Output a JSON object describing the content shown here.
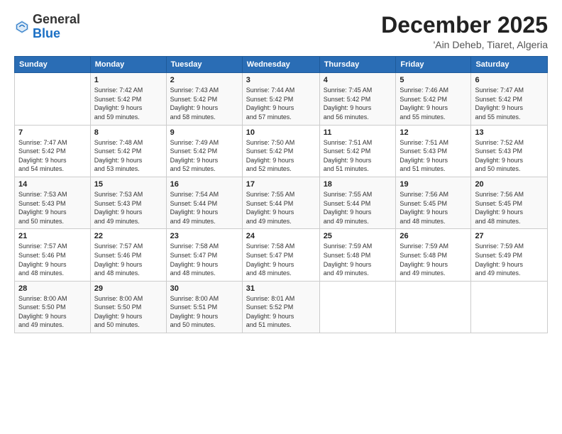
{
  "logo": {
    "general": "General",
    "blue": "Blue"
  },
  "header": {
    "month": "December 2025",
    "location": "'Ain Deheb, Tiaret, Algeria"
  },
  "days_of_week": [
    "Sunday",
    "Monday",
    "Tuesday",
    "Wednesday",
    "Thursday",
    "Friday",
    "Saturday"
  ],
  "weeks": [
    [
      {
        "day": "",
        "info": ""
      },
      {
        "day": "1",
        "info": "Sunrise: 7:42 AM\nSunset: 5:42 PM\nDaylight: 9 hours\nand 59 minutes."
      },
      {
        "day": "2",
        "info": "Sunrise: 7:43 AM\nSunset: 5:42 PM\nDaylight: 9 hours\nand 58 minutes."
      },
      {
        "day": "3",
        "info": "Sunrise: 7:44 AM\nSunset: 5:42 PM\nDaylight: 9 hours\nand 57 minutes."
      },
      {
        "day": "4",
        "info": "Sunrise: 7:45 AM\nSunset: 5:42 PM\nDaylight: 9 hours\nand 56 minutes."
      },
      {
        "day": "5",
        "info": "Sunrise: 7:46 AM\nSunset: 5:42 PM\nDaylight: 9 hours\nand 55 minutes."
      },
      {
        "day": "6",
        "info": "Sunrise: 7:47 AM\nSunset: 5:42 PM\nDaylight: 9 hours\nand 55 minutes."
      }
    ],
    [
      {
        "day": "7",
        "info": "Sunrise: 7:47 AM\nSunset: 5:42 PM\nDaylight: 9 hours\nand 54 minutes."
      },
      {
        "day": "8",
        "info": "Sunrise: 7:48 AM\nSunset: 5:42 PM\nDaylight: 9 hours\nand 53 minutes."
      },
      {
        "day": "9",
        "info": "Sunrise: 7:49 AM\nSunset: 5:42 PM\nDaylight: 9 hours\nand 52 minutes."
      },
      {
        "day": "10",
        "info": "Sunrise: 7:50 AM\nSunset: 5:42 PM\nDaylight: 9 hours\nand 52 minutes."
      },
      {
        "day": "11",
        "info": "Sunrise: 7:51 AM\nSunset: 5:42 PM\nDaylight: 9 hours\nand 51 minutes."
      },
      {
        "day": "12",
        "info": "Sunrise: 7:51 AM\nSunset: 5:43 PM\nDaylight: 9 hours\nand 51 minutes."
      },
      {
        "day": "13",
        "info": "Sunrise: 7:52 AM\nSunset: 5:43 PM\nDaylight: 9 hours\nand 50 minutes."
      }
    ],
    [
      {
        "day": "14",
        "info": "Sunrise: 7:53 AM\nSunset: 5:43 PM\nDaylight: 9 hours\nand 50 minutes."
      },
      {
        "day": "15",
        "info": "Sunrise: 7:53 AM\nSunset: 5:43 PM\nDaylight: 9 hours\nand 49 minutes."
      },
      {
        "day": "16",
        "info": "Sunrise: 7:54 AM\nSunset: 5:44 PM\nDaylight: 9 hours\nand 49 minutes."
      },
      {
        "day": "17",
        "info": "Sunrise: 7:55 AM\nSunset: 5:44 PM\nDaylight: 9 hours\nand 49 minutes."
      },
      {
        "day": "18",
        "info": "Sunrise: 7:55 AM\nSunset: 5:44 PM\nDaylight: 9 hours\nand 49 minutes."
      },
      {
        "day": "19",
        "info": "Sunrise: 7:56 AM\nSunset: 5:45 PM\nDaylight: 9 hours\nand 48 minutes."
      },
      {
        "day": "20",
        "info": "Sunrise: 7:56 AM\nSunset: 5:45 PM\nDaylight: 9 hours\nand 48 minutes."
      }
    ],
    [
      {
        "day": "21",
        "info": "Sunrise: 7:57 AM\nSunset: 5:46 PM\nDaylight: 9 hours\nand 48 minutes."
      },
      {
        "day": "22",
        "info": "Sunrise: 7:57 AM\nSunset: 5:46 PM\nDaylight: 9 hours\nand 48 minutes."
      },
      {
        "day": "23",
        "info": "Sunrise: 7:58 AM\nSunset: 5:47 PM\nDaylight: 9 hours\nand 48 minutes."
      },
      {
        "day": "24",
        "info": "Sunrise: 7:58 AM\nSunset: 5:47 PM\nDaylight: 9 hours\nand 48 minutes."
      },
      {
        "day": "25",
        "info": "Sunrise: 7:59 AM\nSunset: 5:48 PM\nDaylight: 9 hours\nand 49 minutes."
      },
      {
        "day": "26",
        "info": "Sunrise: 7:59 AM\nSunset: 5:48 PM\nDaylight: 9 hours\nand 49 minutes."
      },
      {
        "day": "27",
        "info": "Sunrise: 7:59 AM\nSunset: 5:49 PM\nDaylight: 9 hours\nand 49 minutes."
      }
    ],
    [
      {
        "day": "28",
        "info": "Sunrise: 8:00 AM\nSunset: 5:50 PM\nDaylight: 9 hours\nand 49 minutes."
      },
      {
        "day": "29",
        "info": "Sunrise: 8:00 AM\nSunset: 5:50 PM\nDaylight: 9 hours\nand 50 minutes."
      },
      {
        "day": "30",
        "info": "Sunrise: 8:00 AM\nSunset: 5:51 PM\nDaylight: 9 hours\nand 50 minutes."
      },
      {
        "day": "31",
        "info": "Sunrise: 8:01 AM\nSunset: 5:52 PM\nDaylight: 9 hours\nand 51 minutes."
      },
      {
        "day": "",
        "info": ""
      },
      {
        "day": "",
        "info": ""
      },
      {
        "day": "",
        "info": ""
      }
    ]
  ]
}
